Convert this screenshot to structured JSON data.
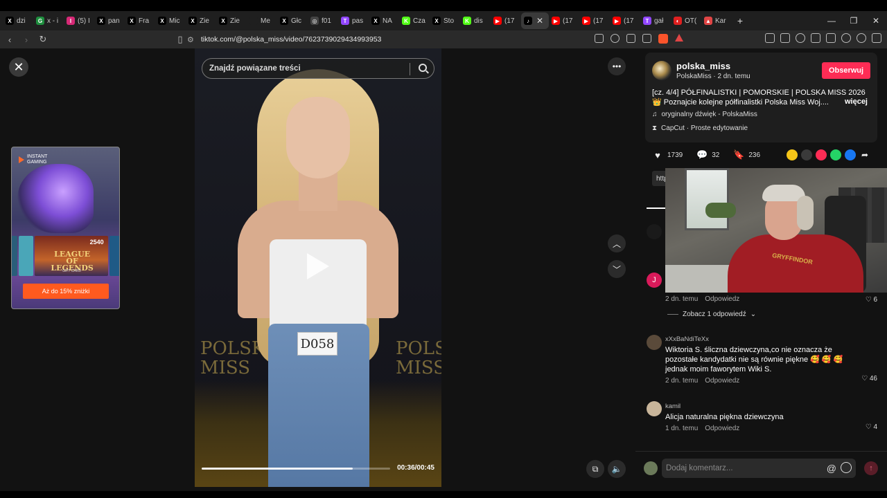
{
  "browser": {
    "tabs": [
      {
        "label": "dzi",
        "fav": "X",
        "color": "#000000"
      },
      {
        "label": "x - i",
        "fav": "G",
        "color": "#1e8e3e"
      },
      {
        "label": "(5) I",
        "fav": "I",
        "color": "#d62976"
      },
      {
        "label": "pan",
        "fav": "X",
        "color": "#000000"
      },
      {
        "label": "Fra",
        "fav": "X",
        "color": "#000000"
      },
      {
        "label": "Mic",
        "fav": "X",
        "color": "#000000"
      },
      {
        "label": "Zie",
        "fav": "X",
        "color": "#000000"
      },
      {
        "label": "Zie",
        "fav": "X",
        "color": "#000000"
      },
      {
        "label": "Me",
        "fav": "",
        "color": "#1f1f1f"
      },
      {
        "label": "Głc",
        "fav": "X",
        "color": "#000000"
      },
      {
        "label": "f01",
        "fav": "◎",
        "color": "#444444"
      },
      {
        "label": "pas",
        "fav": "T",
        "color": "#9146ff"
      },
      {
        "label": "NA",
        "fav": "X",
        "color": "#000000"
      },
      {
        "label": "Cza",
        "fav": "K",
        "color": "#53fc18"
      },
      {
        "label": "Sto",
        "fav": "X",
        "color": "#000000"
      },
      {
        "label": "dis",
        "fav": "K",
        "color": "#53fc18"
      },
      {
        "label": "(17",
        "fav": "▶",
        "color": "#ff0000"
      }
    ],
    "active_tab": {
      "label": "",
      "fav": "♪",
      "color": "#000000"
    },
    "tabs_after": [
      {
        "label": "(17",
        "fav": "▶",
        "color": "#ff0000"
      },
      {
        "label": "(17",
        "fav": "▶",
        "color": "#ff0000"
      },
      {
        "label": "(17",
        "fav": "▶",
        "color": "#ff0000"
      },
      {
        "label": "gał",
        "fav": "T",
        "color": "#9146ff"
      },
      {
        "label": "OT(",
        "fav": "◐",
        "color": "#e02020"
      },
      {
        "label": "Kar",
        "fav": "▲",
        "color": "#e04545"
      }
    ],
    "new_tab": "+",
    "window_controls": [
      "—",
      "❐",
      "✕"
    ],
    "url": "tiktok.com/@polska_miss/video/7623739029434993953"
  },
  "ad": {
    "brand": "INSTANT GAMING",
    "price": "2540",
    "logo_text": "LEAGUE OF LEGENDS",
    "gift": "GIFT CARD",
    "cta": "Aż do 15% zniżki"
  },
  "video": {
    "search_placeholder": "Znajdź powiązane treści",
    "tag_number": "D058",
    "bg_left": "POLSKA MISS",
    "bg_right": "POLS MISS",
    "progress": 0.8,
    "timecode": "00:36/00:45"
  },
  "post": {
    "username": "polska_miss",
    "subline": "PolskaMiss · 2 dn. temu",
    "follow_label": "Obserwuj",
    "description": "[cz. 4/4] PÓŁFINALISTKI | POMORSKIE | POLSKA MISS 2026 👑 Poznajcie kolejne półfinalistki Polska Miss Woj....",
    "more_label": "więcej",
    "music": "oryginalny dźwięk - PolskaMiss",
    "capcut": "CapCut · Proste edytowanie",
    "likes": "1739",
    "comments": "32",
    "saves": "236",
    "link_chip": "http"
  },
  "comments": [
    {
      "avatar_letter": "J",
      "time": "2 dn. temu",
      "reply": "Odpowiedz",
      "likes": "6",
      "more_replies": "Zobacz 1 odpowiedź"
    },
    {
      "name": "xXxBaNdiTeXx",
      "text": "Wiktoria S. śliczna dziewczyna,co nie oznacza że pozostałe kandydatki nie są równie piękne 🥰 🥰 🥰 jednak moim faworytem Wiki S.",
      "time": "2 dn. temu",
      "reply": "Odpowiedz",
      "likes": "46"
    },
    {
      "name": "kamil",
      "text": "Alicja naturalna piękna dziewczyna",
      "time": "1 dn. temu",
      "reply": "Odpowiedz",
      "likes": "4"
    }
  ],
  "comment_input": {
    "placeholder": "Dodaj komentarz...",
    "at": "@"
  },
  "webcam": {
    "hoodie_text": "GRYFFINDOR"
  }
}
